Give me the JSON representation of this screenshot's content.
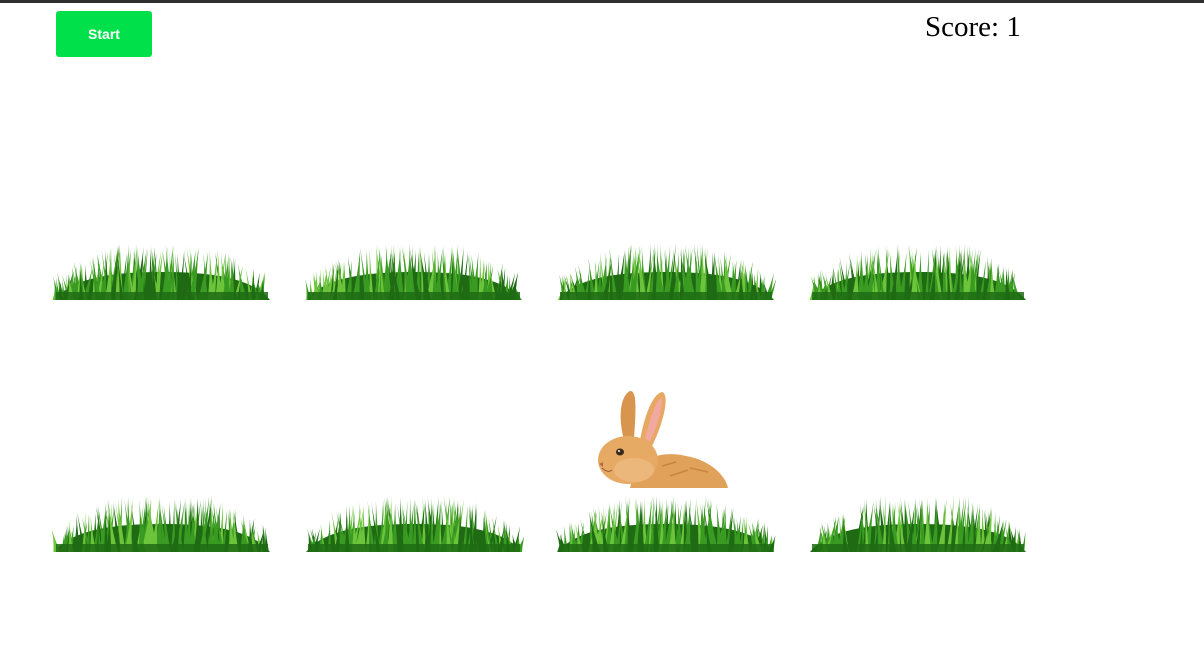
{
  "controls": {
    "start_label": "Start",
    "start_color": "#00e04b"
  },
  "score": {
    "text": "Score: 1",
    "value": 1
  },
  "board": {
    "rows": 2,
    "columns": 4,
    "hole_icon": "grass-icon",
    "mole_icon": "rabbit-icon",
    "active_hole": {
      "row": 2,
      "column": 3
    }
  },
  "colors": {
    "grass_dark": "#1f6b14",
    "grass_mid": "#3a9b22",
    "grass_light": "#6cc43a",
    "rabbit_fur": "#e0a15a",
    "rabbit_ear_inner": "#f2a9a0"
  }
}
